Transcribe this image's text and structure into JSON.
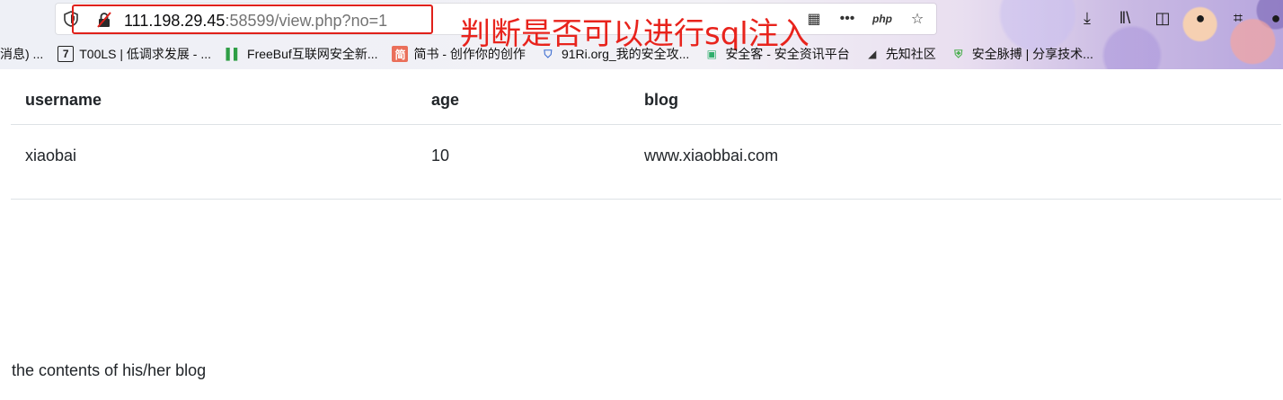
{
  "browser": {
    "url": {
      "host": "111.198.29.45",
      "rest": ":58599/view.php?no=1"
    },
    "annotation": "判断是否可以进行sql注入",
    "url_actions": [
      {
        "icon": "qr-code-icon",
        "glyph": "▦"
      },
      {
        "icon": "more-icon",
        "glyph": "•••"
      },
      {
        "icon": "php-icon",
        "glyph": "php"
      },
      {
        "icon": "bookmark-star-icon",
        "glyph": "☆"
      }
    ],
    "toolbar": [
      {
        "icon": "download-icon",
        "glyph": "⤓"
      },
      {
        "icon": "library-icon",
        "glyph": "‖\\"
      },
      {
        "icon": "sidebar-icon",
        "glyph": "◫"
      },
      {
        "icon": "account-icon",
        "glyph": "●"
      },
      {
        "icon": "crop-icon",
        "glyph": "⌗"
      },
      {
        "icon": "chat-icon",
        "glyph": "●"
      }
    ],
    "bookmarks": [
      {
        "label": "消息) ...",
        "icon": "none",
        "fav": "",
        "color": "#000000"
      },
      {
        "label": "T00LS | 低调求发展 - ...",
        "icon": "t00ls-icon",
        "fav": "7",
        "color": "#222222"
      },
      {
        "label": "FreeBuf互联网安全新...",
        "icon": "freebuf-icon",
        "fav": "▌▌",
        "color": "#2e9e45"
      },
      {
        "label": "简书 - 创作你的创作",
        "icon": "jianshu-icon",
        "fav": "简",
        "color": "#ea6f5a"
      },
      {
        "label": "91Ri.org_我的安全攻...",
        "icon": "shield-icon",
        "fav": "⛉",
        "color": "#3f6fd1"
      },
      {
        "label": "安全客 - 安全资讯平台",
        "icon": "anquanke-icon",
        "fav": "▣",
        "color": "#2fae6c"
      },
      {
        "label": "先知社区",
        "icon": "xianzhi-icon",
        "fav": "◢",
        "color": "#333333"
      },
      {
        "label": "安全脉搏 | 分享技术...",
        "icon": "secpulse-icon",
        "fav": "⛨",
        "color": "#4caf50"
      }
    ]
  },
  "table": {
    "headers": [
      "username",
      "age",
      "blog"
    ],
    "rows": [
      [
        "xiaobai",
        "10",
        "www.xiaobbai.com"
      ]
    ]
  },
  "blog_contents": "the contents of his/her blog"
}
